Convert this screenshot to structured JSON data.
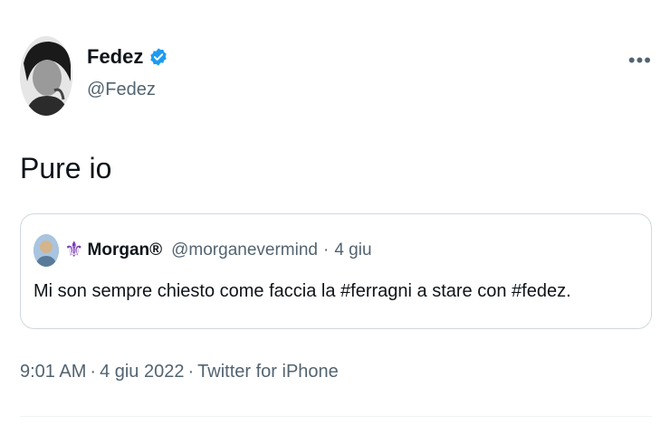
{
  "author": {
    "display_name": "Fedez",
    "handle": "@Fedez"
  },
  "more_label": "•••",
  "tweet_text": "Pure io",
  "quote": {
    "icon": "fleur-de-lis-icon",
    "display_name": "Morgan®",
    "handle": "@morganevermind",
    "separator": "·",
    "date": "4 giu",
    "text": "Mi son sempre chiesto come faccia la #ferragni a stare con #fedez."
  },
  "meta": {
    "time": "9:01 AM",
    "separator1": "·",
    "date": "4 giu 2022",
    "separator2": "·",
    "source": "Twitter for iPhone"
  },
  "colors": {
    "verified": "#1d9bf0",
    "secondary_text": "#536471",
    "border": "#cfd9de"
  }
}
